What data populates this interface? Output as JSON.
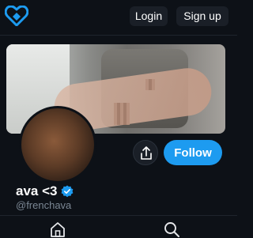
{
  "header": {
    "logo_icon": "heart-logo-icon",
    "login_label": "Login",
    "signup_label": "Sign up"
  },
  "profile": {
    "display_name": "ava <3",
    "handle": "@frenchava",
    "verified_icon": "verified-badge-icon",
    "share_icon": "share-icon",
    "follow_label": "Follow"
  },
  "tabbar": {
    "items": [
      {
        "icon": "home-icon"
      },
      {
        "icon": "search-icon"
      }
    ]
  },
  "colors": {
    "background": "#0d1117",
    "accent": "#1d9bf0",
    "logo": "#1d9bf0",
    "button_dark": "#1a1f27",
    "handle_text": "#7b8794"
  }
}
